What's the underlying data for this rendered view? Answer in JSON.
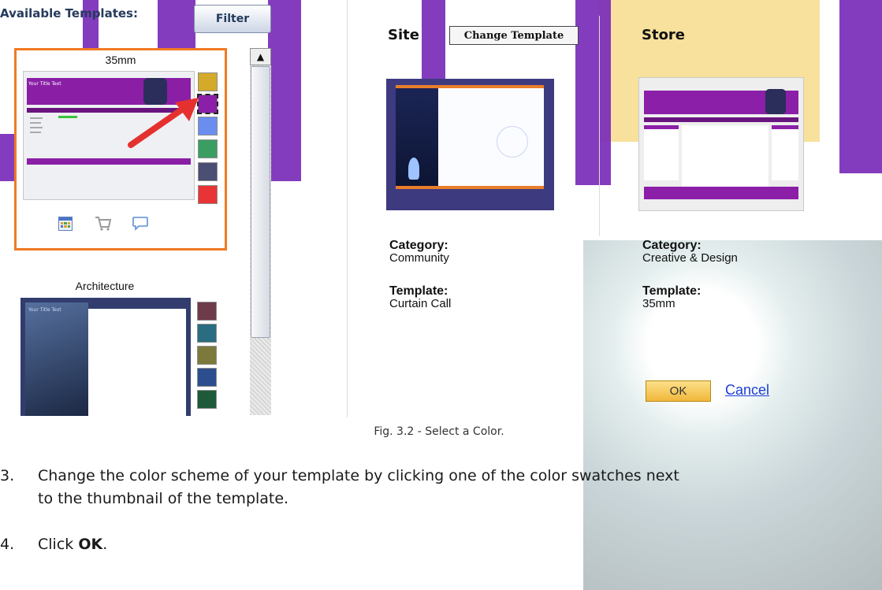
{
  "left_panel": {
    "heading": "Available Templates:",
    "filter_label": "Filter",
    "templates": [
      {
        "name": "35mm",
        "thumb_title": "Your Title Text",
        "swatches": [
          "#d4aa2a",
          "#8b1fa8",
          "#6a8ef0",
          "#3a9e62",
          "#4b4f74",
          "#e83434"
        ]
      },
      {
        "name": "Architecture",
        "thumb_title": "Your Title Text",
        "swatches": [
          "#6e3b4a",
          "#2b6d80",
          "#7b7a3c",
          "#2d4e8e",
          "#1e5a3a"
        ]
      }
    ],
    "scroll_up_glyph": "▲"
  },
  "right_panel": {
    "site_heading": "Site",
    "change_template_label": "Change Template",
    "store_heading": "Store",
    "category_label": "Category:",
    "template_label": "Template:",
    "site_category": "Community",
    "site_template": "Curtain Call",
    "store_category": "Creative & Design",
    "store_template": "35mm",
    "ok_label": "OK",
    "cancel_label": "Cancel"
  },
  "figure_caption": "Fig. 3.2 - Select a Color.",
  "steps": [
    {
      "num": "3.",
      "text_line1": "Change the color scheme of your template by clicking one of the color swatches next",
      "text_line2": "to the thumbnail of the template."
    },
    {
      "num": "4.",
      "prefix": "Click ",
      "bold": "OK",
      "suffix": "."
    }
  ],
  "icons": [
    "calendar-icon",
    "shopping-cart-icon",
    "chat-bubble-icon",
    "red-arrow-icon"
  ],
  "colors": {
    "highlight_border": "#f07a22",
    "watermark": "#7a2bb8",
    "link": "#1b3fd6"
  }
}
